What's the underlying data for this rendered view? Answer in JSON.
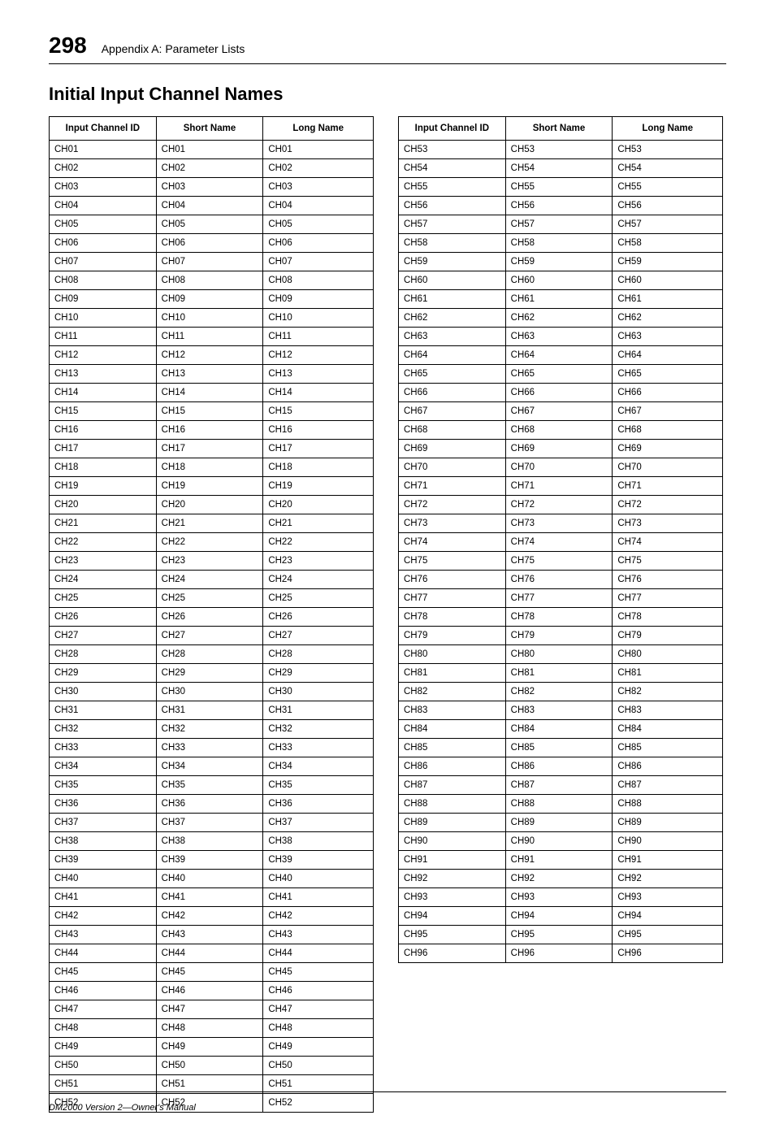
{
  "page_number": "298",
  "appendix_label": "Appendix A: Parameter Lists",
  "section_title": "Initial Input Channel Names",
  "footer_text": "DM2000 Version 2—Owner's Manual",
  "table_headers": {
    "id": "Input Channel ID",
    "short": "Short Name",
    "long": "Long Name"
  },
  "table_a": [
    {
      "id": "CH01",
      "short": "CH01",
      "long": "CH01"
    },
    {
      "id": "CH02",
      "short": "CH02",
      "long": "CH02"
    },
    {
      "id": "CH03",
      "short": "CH03",
      "long": "CH03"
    },
    {
      "id": "CH04",
      "short": "CH04",
      "long": "CH04"
    },
    {
      "id": "CH05",
      "short": "CH05",
      "long": "CH05"
    },
    {
      "id": "CH06",
      "short": "CH06",
      "long": "CH06"
    },
    {
      "id": "CH07",
      "short": "CH07",
      "long": "CH07"
    },
    {
      "id": "CH08",
      "short": "CH08",
      "long": "CH08"
    },
    {
      "id": "CH09",
      "short": "CH09",
      "long": "CH09"
    },
    {
      "id": "CH10",
      "short": "CH10",
      "long": "CH10"
    },
    {
      "id": "CH11",
      "short": "CH11",
      "long": "CH11"
    },
    {
      "id": "CH12",
      "short": "CH12",
      "long": "CH12"
    },
    {
      "id": "CH13",
      "short": "CH13",
      "long": "CH13"
    },
    {
      "id": "CH14",
      "short": "CH14",
      "long": "CH14"
    },
    {
      "id": "CH15",
      "short": "CH15",
      "long": "CH15"
    },
    {
      "id": "CH16",
      "short": "CH16",
      "long": "CH16"
    },
    {
      "id": "CH17",
      "short": "CH17",
      "long": "CH17"
    },
    {
      "id": "CH18",
      "short": "CH18",
      "long": "CH18"
    },
    {
      "id": "CH19",
      "short": "CH19",
      "long": "CH19"
    },
    {
      "id": "CH20",
      "short": "CH20",
      "long": "CH20"
    },
    {
      "id": "CH21",
      "short": "CH21",
      "long": "CH21"
    },
    {
      "id": "CH22",
      "short": "CH22",
      "long": "CH22"
    },
    {
      "id": "CH23",
      "short": "CH23",
      "long": "CH23"
    },
    {
      "id": "CH24",
      "short": "CH24",
      "long": "CH24"
    },
    {
      "id": "CH25",
      "short": "CH25",
      "long": "CH25"
    },
    {
      "id": "CH26",
      "short": "CH26",
      "long": "CH26"
    },
    {
      "id": "CH27",
      "short": "CH27",
      "long": "CH27"
    },
    {
      "id": "CH28",
      "short": "CH28",
      "long": "CH28"
    },
    {
      "id": "CH29",
      "short": "CH29",
      "long": "CH29"
    },
    {
      "id": "CH30",
      "short": "CH30",
      "long": "CH30"
    },
    {
      "id": "CH31",
      "short": "CH31",
      "long": "CH31"
    },
    {
      "id": "CH32",
      "short": "CH32",
      "long": "CH32"
    },
    {
      "id": "CH33",
      "short": "CH33",
      "long": "CH33"
    },
    {
      "id": "CH34",
      "short": "CH34",
      "long": "CH34"
    },
    {
      "id": "CH35",
      "short": "CH35",
      "long": "CH35"
    },
    {
      "id": "CH36",
      "short": "CH36",
      "long": "CH36"
    },
    {
      "id": "CH37",
      "short": "CH37",
      "long": "CH37"
    },
    {
      "id": "CH38",
      "short": "CH38",
      "long": "CH38"
    },
    {
      "id": "CH39",
      "short": "CH39",
      "long": "CH39"
    },
    {
      "id": "CH40",
      "short": "CH40",
      "long": "CH40"
    },
    {
      "id": "CH41",
      "short": "CH41",
      "long": "CH41"
    },
    {
      "id": "CH42",
      "short": "CH42",
      "long": "CH42"
    },
    {
      "id": "CH43",
      "short": "CH43",
      "long": "CH43"
    },
    {
      "id": "CH44",
      "short": "CH44",
      "long": "CH44"
    },
    {
      "id": "CH45",
      "short": "CH45",
      "long": "CH45"
    },
    {
      "id": "CH46",
      "short": "CH46",
      "long": "CH46"
    },
    {
      "id": "CH47",
      "short": "CH47",
      "long": "CH47"
    },
    {
      "id": "CH48",
      "short": "CH48",
      "long": "CH48"
    },
    {
      "id": "CH49",
      "short": "CH49",
      "long": "CH49"
    },
    {
      "id": "CH50",
      "short": "CH50",
      "long": "CH50"
    },
    {
      "id": "CH51",
      "short": "CH51",
      "long": "CH51"
    },
    {
      "id": "CH52",
      "short": "CH52",
      "long": "CH52"
    }
  ],
  "table_b": [
    {
      "id": "CH53",
      "short": "CH53",
      "long": "CH53"
    },
    {
      "id": "CH54",
      "short": "CH54",
      "long": "CH54"
    },
    {
      "id": "CH55",
      "short": "CH55",
      "long": "CH55"
    },
    {
      "id": "CH56",
      "short": "CH56",
      "long": "CH56"
    },
    {
      "id": "CH57",
      "short": "CH57",
      "long": "CH57"
    },
    {
      "id": "CH58",
      "short": "CH58",
      "long": "CH58"
    },
    {
      "id": "CH59",
      "short": "CH59",
      "long": "CH59"
    },
    {
      "id": "CH60",
      "short": "CH60",
      "long": "CH60"
    },
    {
      "id": "CH61",
      "short": "CH61",
      "long": "CH61"
    },
    {
      "id": "CH62",
      "short": "CH62",
      "long": "CH62"
    },
    {
      "id": "CH63",
      "short": "CH63",
      "long": "CH63"
    },
    {
      "id": "CH64",
      "short": "CH64",
      "long": "CH64"
    },
    {
      "id": "CH65",
      "short": "CH65",
      "long": "CH65"
    },
    {
      "id": "CH66",
      "short": "CH66",
      "long": "CH66"
    },
    {
      "id": "CH67",
      "short": "CH67",
      "long": "CH67"
    },
    {
      "id": "CH68",
      "short": "CH68",
      "long": "CH68"
    },
    {
      "id": "CH69",
      "short": "CH69",
      "long": "CH69"
    },
    {
      "id": "CH70",
      "short": "CH70",
      "long": "CH70"
    },
    {
      "id": "CH71",
      "short": "CH71",
      "long": "CH71"
    },
    {
      "id": "CH72",
      "short": "CH72",
      "long": "CH72"
    },
    {
      "id": "CH73",
      "short": "CH73",
      "long": "CH73"
    },
    {
      "id": "CH74",
      "short": "CH74",
      "long": "CH74"
    },
    {
      "id": "CH75",
      "short": "CH75",
      "long": "CH75"
    },
    {
      "id": "CH76",
      "short": "CH76",
      "long": "CH76"
    },
    {
      "id": "CH77",
      "short": "CH77",
      "long": "CH77"
    },
    {
      "id": "CH78",
      "short": "CH78",
      "long": "CH78"
    },
    {
      "id": "CH79",
      "short": "CH79",
      "long": "CH79"
    },
    {
      "id": "CH80",
      "short": "CH80",
      "long": "CH80"
    },
    {
      "id": "CH81",
      "short": "CH81",
      "long": "CH81"
    },
    {
      "id": "CH82",
      "short": "CH82",
      "long": "CH82"
    },
    {
      "id": "CH83",
      "short": "CH83",
      "long": "CH83"
    },
    {
      "id": "CH84",
      "short": "CH84",
      "long": "CH84"
    },
    {
      "id": "CH85",
      "short": "CH85",
      "long": "CH85"
    },
    {
      "id": "CH86",
      "short": "CH86",
      "long": "CH86"
    },
    {
      "id": "CH87",
      "short": "CH87",
      "long": "CH87"
    },
    {
      "id": "CH88",
      "short": "CH88",
      "long": "CH88"
    },
    {
      "id": "CH89",
      "short": "CH89",
      "long": "CH89"
    },
    {
      "id": "CH90",
      "short": "CH90",
      "long": "CH90"
    },
    {
      "id": "CH91",
      "short": "CH91",
      "long": "CH91"
    },
    {
      "id": "CH92",
      "short": "CH92",
      "long": "CH92"
    },
    {
      "id": "CH93",
      "short": "CH93",
      "long": "CH93"
    },
    {
      "id": "CH94",
      "short": "CH94",
      "long": "CH94"
    },
    {
      "id": "CH95",
      "short": "CH95",
      "long": "CH95"
    },
    {
      "id": "CH96",
      "short": "CH96",
      "long": "CH96"
    }
  ]
}
